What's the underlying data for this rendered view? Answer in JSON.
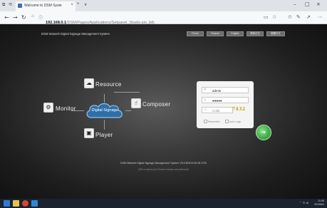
{
  "browser": {
    "tab_title": "Welcome to DSM Syste",
    "tab_close": "×",
    "new_tab": "+",
    "tab_menu": "∨",
    "url_host": "192.168.0.1",
    "url_path": "/DSM/Pages/Applications/Setpanel_Studio.aio_b/b",
    "win_min": "–",
    "win_max": "□",
    "win_close": "×"
  },
  "page": {
    "system_title": "DSM Network Digital Signage Management System",
    "top_buttons": [
      "Forum",
      "Feature",
      "English",
      "简体中文",
      "繁體中文"
    ],
    "nodes": {
      "resource": "Resource",
      "composer": "Composer",
      "monitor": "Monitor",
      "player": "Player",
      "center": "Digital Signage"
    },
    "login": {
      "username": "admin",
      "password": "●●●●●",
      "code_placeholder": "Code",
      "captcha": "7432",
      "remember_label": "Remember",
      "autologin_label": "Auto Login",
      "login_arrow": "➜"
    },
    "footer_line1": "DSM Network Digital Signage Management System V5.6 B2019.05.28.1703",
    "footer_line2": "(IE9 or above and Chrome browser are preferred)"
  },
  "taskbar": {
    "time": "11:49",
    "date": "2019/6/4",
    "sys_icons": "⌃ ⊡ ◂)"
  },
  "colors": {
    "login_button": "#3fb04a",
    "captcha": "#c9a300",
    "background_center": "#5a5a5a",
    "taskbar": "#1b2230"
  }
}
